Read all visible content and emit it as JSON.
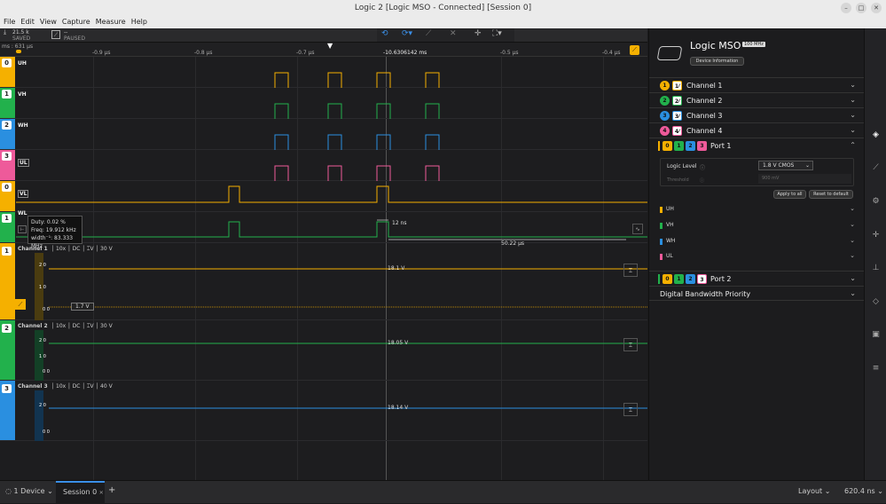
{
  "window": {
    "title": "Logic 2 [Logic MSO - Connected] [Session 0]"
  },
  "menu": [
    "File",
    "Edit",
    "View",
    "Capture",
    "Measure",
    "Help"
  ],
  "toolbar": {
    "samples_value": "21.5 k",
    "samples_status": "SAVED",
    "run_value": "--",
    "run_status": "PAUSED"
  },
  "ruler": {
    "offset": "ms : 631 µs",
    "center_time": "-10.6306142 ms",
    "ticks": [
      "-0.9 µs",
      "-0.8 µs",
      "-0.7 µs",
      "-0.6 µs",
      "-0.5 µs",
      "-0.4 µs"
    ]
  },
  "digital_rows": [
    {
      "num": "0",
      "name": "UH",
      "color": "#f5b000"
    },
    {
      "num": "1",
      "name": "VH",
      "color": "#22b14c"
    },
    {
      "num": "2",
      "name": "WH",
      "color": "#2a8fe0"
    },
    {
      "num": "3",
      "name": "UL",
      "color": "#ee5a9a"
    },
    {
      "num": "0",
      "name": "VL",
      "color": "#f5b000"
    },
    {
      "num": "1",
      "name": "WL",
      "color": "#22b14c"
    }
  ],
  "measure": {
    "pulse_width": "12 ns",
    "period": "50.22 µs"
  },
  "tooltip": {
    "duty": "Duty: 0.02 %",
    "freq": "Freq: 19.912 kHz",
    "width": "width⁻¹: 83.333 MHz"
  },
  "analog_rows": [
    {
      "num": "1",
      "name": "Channel 1",
      "probe": "10x",
      "coupling": "DC",
      "range": "30 V",
      "ticks": [
        "2 0",
        "1 0",
        "0 0"
      ],
      "value": "18.1 V",
      "trigger": "1.7 V",
      "color": "#f5b000"
    },
    {
      "num": "2",
      "name": "Channel 2",
      "probe": "10x",
      "coupling": "DC",
      "range": "30 V",
      "ticks": [
        "2 0",
        "1 0",
        "0 0"
      ],
      "value": "18.05 V",
      "color": "#22b14c"
    },
    {
      "num": "3",
      "name": "Channel 3",
      "probe": "10x",
      "coupling": "DC",
      "range": "40 V",
      "ticks": [
        "2 0",
        "0 0"
      ],
      "value": "18.14 V",
      "color": "#2a8fe0"
    }
  ],
  "panel": {
    "device_name": "Logic MSO",
    "device_badge": "100 MHz",
    "device_info_label": "Device Information",
    "channels": [
      {
        "num": "1",
        "label": "Channel 1",
        "color": "#f5b000"
      },
      {
        "num": "2",
        "label": "Channel 2",
        "color": "#22b14c"
      },
      {
        "num": "3",
        "label": "Channel 3",
        "color": "#2a8fe0"
      },
      {
        "num": "4",
        "label": "Channel 4",
        "color": "#ee5a9a"
      }
    ],
    "port1": {
      "label": "Port 1",
      "logic_level_label": "Logic Level",
      "logic_level_value": "1.8 V CMOS",
      "threshold_label": "Threshold",
      "threshold_value": "900 mV",
      "apply_all": "Apply to all",
      "reset_default": "Reset to default",
      "signals": [
        {
          "name": "UH",
          "color": "#f5b000"
        },
        {
          "name": "VH",
          "color": "#22b14c"
        },
        {
          "name": "WH",
          "color": "#2a8fe0"
        },
        {
          "name": "UL",
          "color": "#ee5a9a"
        }
      ]
    },
    "port2": {
      "label": "Port 2"
    },
    "bandwidth_label": "Digital Bandwidth Priority"
  },
  "statusbar": {
    "device": "1 Device",
    "session": "Session 0",
    "layout": "Layout",
    "zoom": "620.4 ns"
  }
}
